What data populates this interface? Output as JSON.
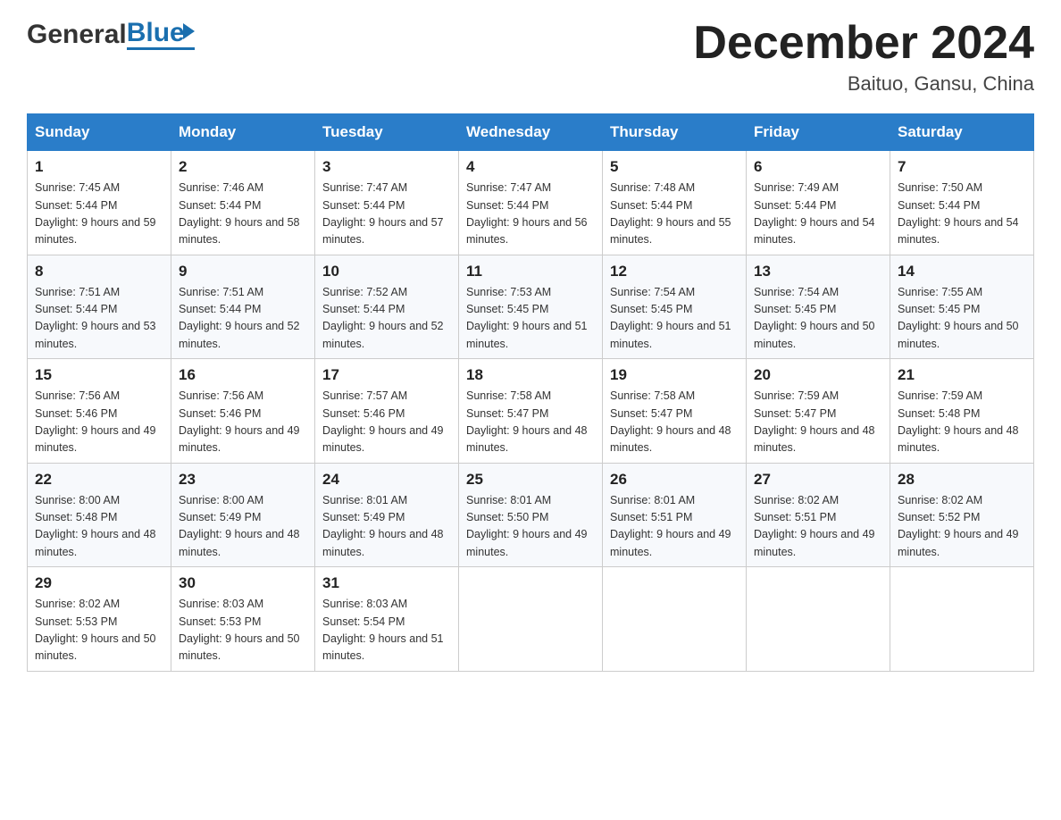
{
  "header": {
    "logo_general": "General",
    "logo_blue": "Blue",
    "month_title": "December 2024",
    "location": "Baituo, Gansu, China"
  },
  "days_of_week": [
    "Sunday",
    "Monday",
    "Tuesday",
    "Wednesday",
    "Thursday",
    "Friday",
    "Saturday"
  ],
  "weeks": [
    [
      {
        "day": "1",
        "sunrise": "Sunrise: 7:45 AM",
        "sunset": "Sunset: 5:44 PM",
        "daylight": "Daylight: 9 hours and 59 minutes."
      },
      {
        "day": "2",
        "sunrise": "Sunrise: 7:46 AM",
        "sunset": "Sunset: 5:44 PM",
        "daylight": "Daylight: 9 hours and 58 minutes."
      },
      {
        "day": "3",
        "sunrise": "Sunrise: 7:47 AM",
        "sunset": "Sunset: 5:44 PM",
        "daylight": "Daylight: 9 hours and 57 minutes."
      },
      {
        "day": "4",
        "sunrise": "Sunrise: 7:47 AM",
        "sunset": "Sunset: 5:44 PM",
        "daylight": "Daylight: 9 hours and 56 minutes."
      },
      {
        "day": "5",
        "sunrise": "Sunrise: 7:48 AM",
        "sunset": "Sunset: 5:44 PM",
        "daylight": "Daylight: 9 hours and 55 minutes."
      },
      {
        "day": "6",
        "sunrise": "Sunrise: 7:49 AM",
        "sunset": "Sunset: 5:44 PM",
        "daylight": "Daylight: 9 hours and 54 minutes."
      },
      {
        "day": "7",
        "sunrise": "Sunrise: 7:50 AM",
        "sunset": "Sunset: 5:44 PM",
        "daylight": "Daylight: 9 hours and 54 minutes."
      }
    ],
    [
      {
        "day": "8",
        "sunrise": "Sunrise: 7:51 AM",
        "sunset": "Sunset: 5:44 PM",
        "daylight": "Daylight: 9 hours and 53 minutes."
      },
      {
        "day": "9",
        "sunrise": "Sunrise: 7:51 AM",
        "sunset": "Sunset: 5:44 PM",
        "daylight": "Daylight: 9 hours and 52 minutes."
      },
      {
        "day": "10",
        "sunrise": "Sunrise: 7:52 AM",
        "sunset": "Sunset: 5:44 PM",
        "daylight": "Daylight: 9 hours and 52 minutes."
      },
      {
        "day": "11",
        "sunrise": "Sunrise: 7:53 AM",
        "sunset": "Sunset: 5:45 PM",
        "daylight": "Daylight: 9 hours and 51 minutes."
      },
      {
        "day": "12",
        "sunrise": "Sunrise: 7:54 AM",
        "sunset": "Sunset: 5:45 PM",
        "daylight": "Daylight: 9 hours and 51 minutes."
      },
      {
        "day": "13",
        "sunrise": "Sunrise: 7:54 AM",
        "sunset": "Sunset: 5:45 PM",
        "daylight": "Daylight: 9 hours and 50 minutes."
      },
      {
        "day": "14",
        "sunrise": "Sunrise: 7:55 AM",
        "sunset": "Sunset: 5:45 PM",
        "daylight": "Daylight: 9 hours and 50 minutes."
      }
    ],
    [
      {
        "day": "15",
        "sunrise": "Sunrise: 7:56 AM",
        "sunset": "Sunset: 5:46 PM",
        "daylight": "Daylight: 9 hours and 49 minutes."
      },
      {
        "day": "16",
        "sunrise": "Sunrise: 7:56 AM",
        "sunset": "Sunset: 5:46 PM",
        "daylight": "Daylight: 9 hours and 49 minutes."
      },
      {
        "day": "17",
        "sunrise": "Sunrise: 7:57 AM",
        "sunset": "Sunset: 5:46 PM",
        "daylight": "Daylight: 9 hours and 49 minutes."
      },
      {
        "day": "18",
        "sunrise": "Sunrise: 7:58 AM",
        "sunset": "Sunset: 5:47 PM",
        "daylight": "Daylight: 9 hours and 48 minutes."
      },
      {
        "day": "19",
        "sunrise": "Sunrise: 7:58 AM",
        "sunset": "Sunset: 5:47 PM",
        "daylight": "Daylight: 9 hours and 48 minutes."
      },
      {
        "day": "20",
        "sunrise": "Sunrise: 7:59 AM",
        "sunset": "Sunset: 5:47 PM",
        "daylight": "Daylight: 9 hours and 48 minutes."
      },
      {
        "day": "21",
        "sunrise": "Sunrise: 7:59 AM",
        "sunset": "Sunset: 5:48 PM",
        "daylight": "Daylight: 9 hours and 48 minutes."
      }
    ],
    [
      {
        "day": "22",
        "sunrise": "Sunrise: 8:00 AM",
        "sunset": "Sunset: 5:48 PM",
        "daylight": "Daylight: 9 hours and 48 minutes."
      },
      {
        "day": "23",
        "sunrise": "Sunrise: 8:00 AM",
        "sunset": "Sunset: 5:49 PM",
        "daylight": "Daylight: 9 hours and 48 minutes."
      },
      {
        "day": "24",
        "sunrise": "Sunrise: 8:01 AM",
        "sunset": "Sunset: 5:49 PM",
        "daylight": "Daylight: 9 hours and 48 minutes."
      },
      {
        "day": "25",
        "sunrise": "Sunrise: 8:01 AM",
        "sunset": "Sunset: 5:50 PM",
        "daylight": "Daylight: 9 hours and 49 minutes."
      },
      {
        "day": "26",
        "sunrise": "Sunrise: 8:01 AM",
        "sunset": "Sunset: 5:51 PM",
        "daylight": "Daylight: 9 hours and 49 minutes."
      },
      {
        "day": "27",
        "sunrise": "Sunrise: 8:02 AM",
        "sunset": "Sunset: 5:51 PM",
        "daylight": "Daylight: 9 hours and 49 minutes."
      },
      {
        "day": "28",
        "sunrise": "Sunrise: 8:02 AM",
        "sunset": "Sunset: 5:52 PM",
        "daylight": "Daylight: 9 hours and 49 minutes."
      }
    ],
    [
      {
        "day": "29",
        "sunrise": "Sunrise: 8:02 AM",
        "sunset": "Sunset: 5:53 PM",
        "daylight": "Daylight: 9 hours and 50 minutes."
      },
      {
        "day": "30",
        "sunrise": "Sunrise: 8:03 AM",
        "sunset": "Sunset: 5:53 PM",
        "daylight": "Daylight: 9 hours and 50 minutes."
      },
      {
        "day": "31",
        "sunrise": "Sunrise: 8:03 AM",
        "sunset": "Sunset: 5:54 PM",
        "daylight": "Daylight: 9 hours and 51 minutes."
      },
      null,
      null,
      null,
      null
    ]
  ]
}
